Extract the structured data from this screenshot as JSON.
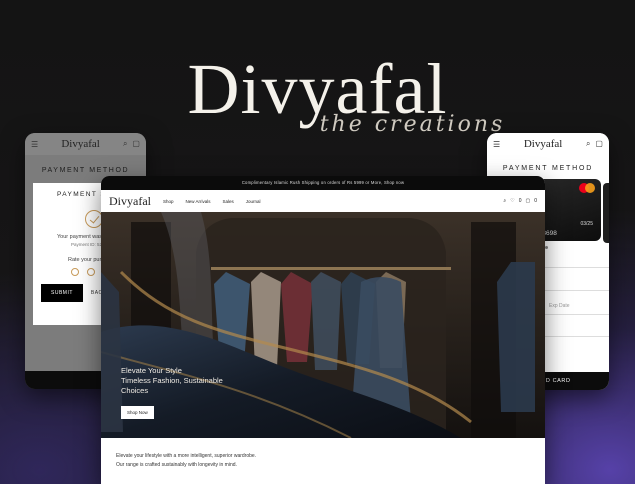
{
  "brand": {
    "name": "Divyafal",
    "tagline": "the creations"
  },
  "left_screen": {
    "logo": "Divyafal",
    "section_title": "PAYMENT METHOD",
    "modal": {
      "title": "PAYMENT SU",
      "success_text": "Your payment was s",
      "payment_id": "Payment ID: 5280",
      "rate_text": "Rate your purch",
      "submit_label": "SUBMIT",
      "back_label": "BACK"
    }
  },
  "right_screen": {
    "logo": "Divyafal",
    "section_title": "PAYMENT METHOD",
    "card": {
      "expiry": "03/25",
      "number": "5 3698"
    },
    "exp_label": "Exp Date",
    "footer_label": "OD CARD"
  },
  "main_screen": {
    "promo_text": "Complimentary Islamic Rush Shipping on orders of Rs 5999 or More, Shop now",
    "logo": "Divyafal",
    "nav_links": [
      "Shop",
      "New Arrivals",
      "Sales",
      "Journal"
    ],
    "nav_icons": [
      "search-icon",
      "wishlist-icon",
      "cart-icon"
    ],
    "wishlist_count": "0",
    "cart_count": "0",
    "hero": {
      "line1": "Elevate Your Style",
      "line2": "Timeless Fashion, Sustainable",
      "line3": "Choices",
      "cta": "Shop Now"
    },
    "copy_line1": "Elevate your lifestyle with a more intelligent, superior wardrobe.",
    "copy_line2": "Our range is crafted sustainably with longevity in mind."
  }
}
